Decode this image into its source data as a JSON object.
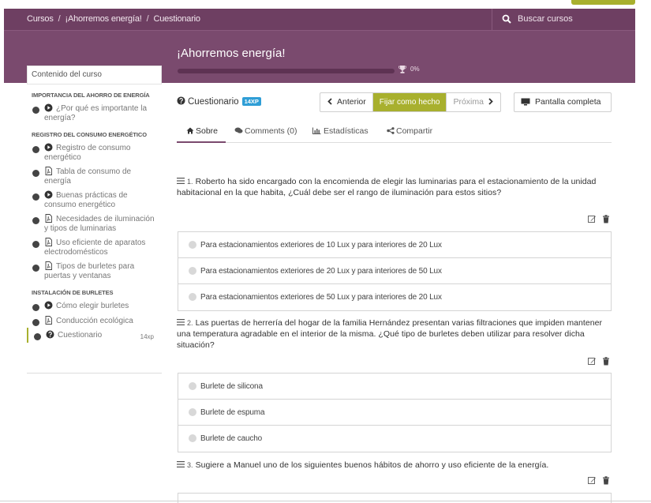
{
  "breadcrumb": [
    "Cursos",
    "¡Ahorremos energía!",
    "Cuestionario"
  ],
  "search": {
    "placeholder": "Buscar cursos"
  },
  "course": {
    "title": "¡Ahorremos energía!",
    "progress_percent": 0,
    "progress_label": "0%"
  },
  "sidebar": {
    "header": "Contenido del curso",
    "sections": [
      {
        "title": "IMPORTANCIA DEL AHORRO DE ENERGÍA",
        "items": [
          {
            "label": "¿Por qué es importante la energía?",
            "kind": "play"
          }
        ]
      },
      {
        "title": "REGISTRO DEL CONSUMO ENERGÉTICO",
        "items": [
          {
            "label": "Registro de consumo energético",
            "kind": "play"
          },
          {
            "label": "Tabla de consumo de energía",
            "kind": "doc"
          },
          {
            "label": "Buenas prácticas de consumo energético",
            "kind": "play"
          },
          {
            "label": "Necesidades de iluminación y tipos de luminarias",
            "kind": "doc"
          },
          {
            "label": "Uso eficiente de aparatos electrodomésticos",
            "kind": "doc"
          },
          {
            "label": "Tipos de burletes para puertas y ventanas",
            "kind": "doc"
          }
        ]
      },
      {
        "title": "INSTALACIÓN DE BURLETES",
        "items": [
          {
            "label": "Cómo elegir burletes",
            "kind": "play"
          },
          {
            "label": "Conducción ecológica",
            "kind": "doc"
          },
          {
            "label": "Cuestionario",
            "kind": "quiz",
            "xp": "14xp",
            "active": true
          }
        ]
      }
    ]
  },
  "lesson": {
    "label": "Cuestionario",
    "xp_badge": "14XP",
    "prev": "Anterior",
    "mark_done": "Fijar como hecho",
    "next": "Próxima",
    "fullscreen": "Pantalla completa"
  },
  "tabs": [
    "Sobre",
    "Comments (0)",
    "Estadísticas",
    "Compartir"
  ],
  "questions": [
    {
      "num": "1.",
      "text": "Roberto ha sido encargado con la encomienda de elegir las luminarias para el estacionamiento de la unidad habitacional en la que habita, ¿Cuál debe ser el rango de iluminación para estos sitios?",
      "options": [
        "Para estacionamientos exteriores de 10 Lux y para interiores de 20 Lux",
        "Para estacionamientos exteriores de 20 Lux y para interiores de 50 Lux",
        "Para estacionamientos exteriores de 50 Lux y para interiores de 20 Lux"
      ]
    },
    {
      "num": "2.",
      "text": "Las puertas de herrería del hogar de la familia Hernández presentan varias filtraciones que impiden mantener una temperatura agradable en el interior de la misma. ¿Qué tipo de burletes deben utilizar para resolver dicha situación?",
      "options": [
        "Burlete de silicona",
        "Burlete de espuma",
        "Burlete de caucho"
      ]
    },
    {
      "num": "3.",
      "text": "Sugiere a Manuel uno de los siguientes buenos hábitos de ahorro y uso eficiente de la energía.",
      "options": []
    }
  ],
  "colors": {
    "header": "#7a4a6e",
    "accent": "#a8b02e",
    "badge": "#2f9ed6"
  }
}
